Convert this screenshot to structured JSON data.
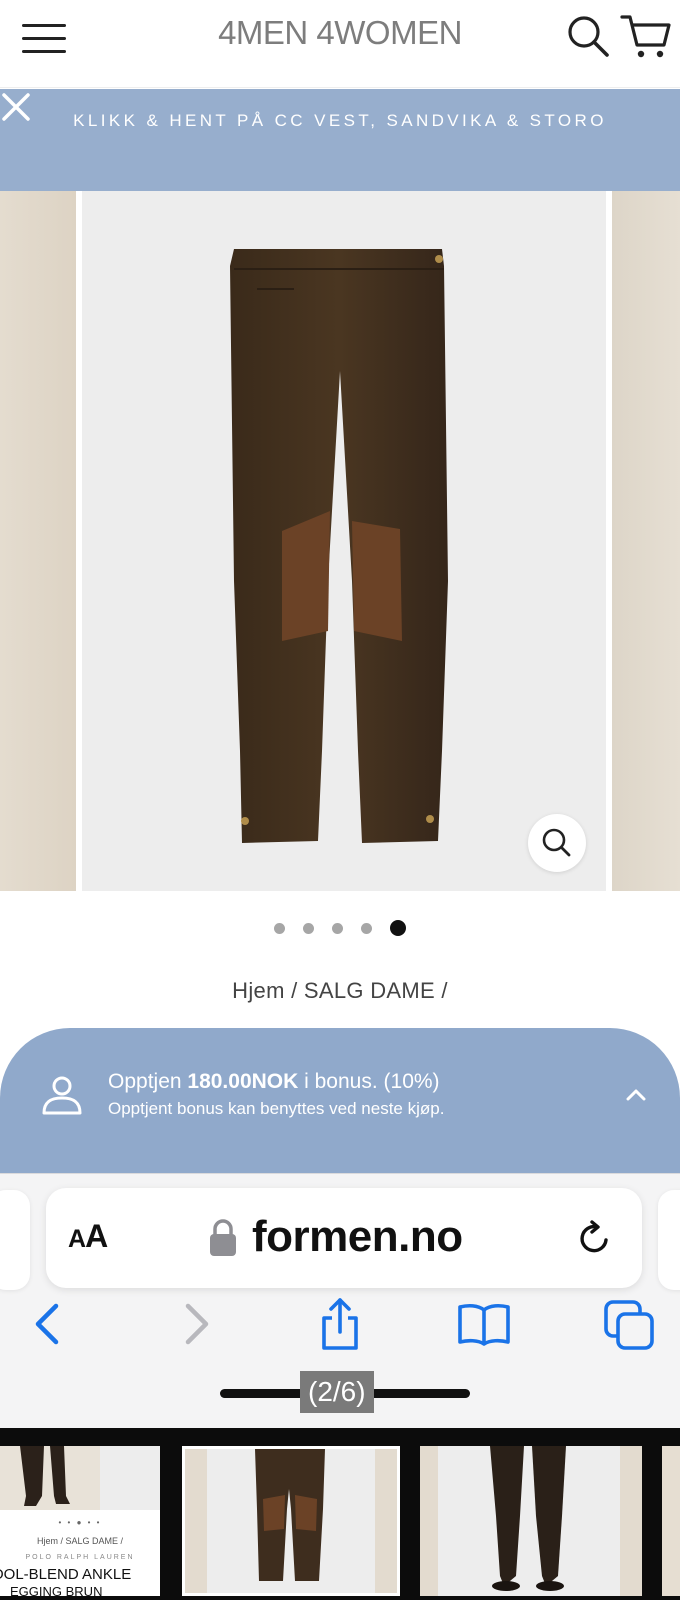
{
  "header": {
    "logo_text": "4MEN 4WOMEN",
    "menu_icon": "hamburger-menu-icon",
    "search_icon": "search-icon",
    "cart_icon": "cart-icon"
  },
  "promo": {
    "text": "KLIKK & HENT PÅ CC VEST, SANDVIKA & STORO",
    "close_icon": "close-icon",
    "bg_color": "#97aecd"
  },
  "gallery": {
    "slide_count": 5,
    "active_slide": 5,
    "zoom_icon": "magnifier-icon"
  },
  "breadcrumb": {
    "text": "Hjem / SALG DAME /"
  },
  "bonus": {
    "line1_prefix": "Opptjen ",
    "line1_amount": "180.00NOK",
    "line1_suffix": " i bonus. (10%)",
    "line2": "Opptjent bonus kan benyttes ved neste kjøp.",
    "user_icon": "user-icon",
    "chevron_icon": "chevron-up-icon",
    "bg_color": "#90a9cb"
  },
  "browser": {
    "aa_big": "A",
    "aa_small": "A",
    "url": "formen.no",
    "lock_icon": "lock-icon",
    "reload_icon": "reload-icon",
    "back_icon": "back-arrow-icon",
    "forward_icon": "forward-arrow-icon",
    "share_icon": "share-icon",
    "bookmarks_icon": "bookmarks-icon",
    "tabs_icon": "tabs-icon",
    "accent_color": "#1a73e8"
  },
  "screenshot_counter": "(2/6)",
  "thumbnails": {
    "t1_dots": "• • ● • •",
    "t1_crumb": "Hjem / SALG DAME /",
    "t1_brand": "POLO RALPH LAUREN",
    "t1_name": "OOL-BLEND ANKLE",
    "t1_name2": "EGGING BRUN"
  }
}
